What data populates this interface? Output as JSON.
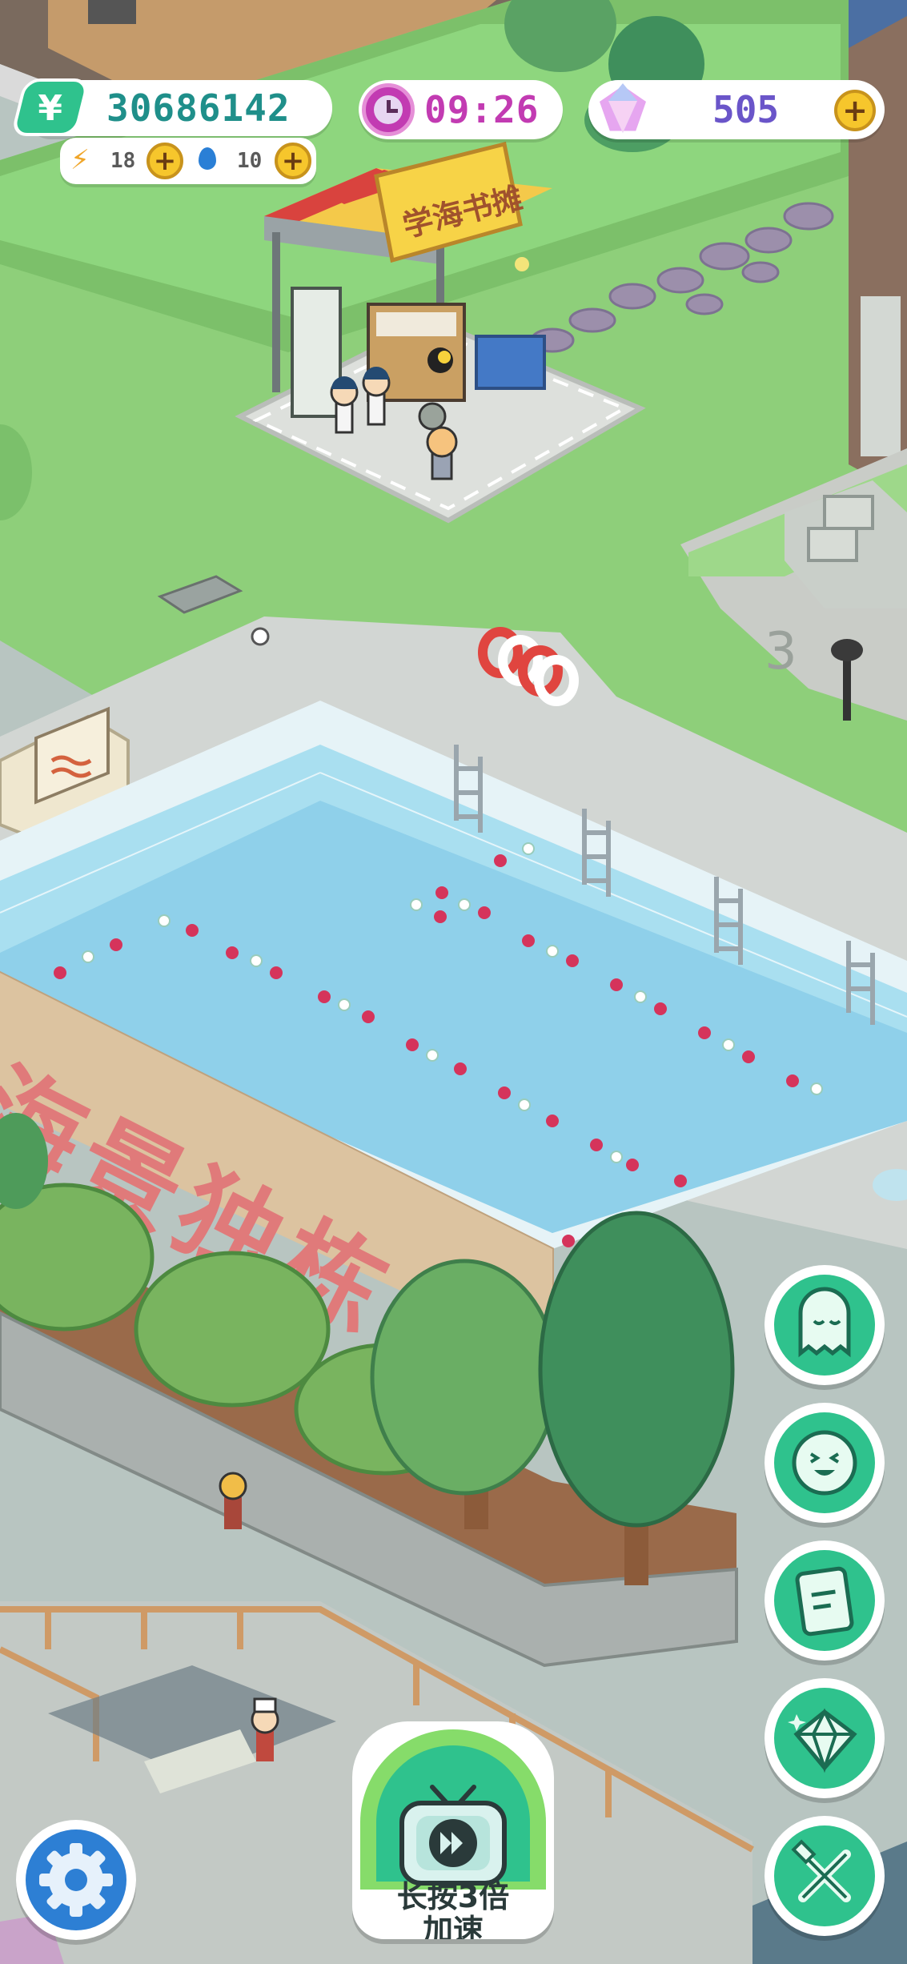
{
  "hud": {
    "money": "30686142",
    "money_icon": "yuan-icon",
    "energy": "18",
    "water": "10",
    "time": "09:26",
    "gems": "505"
  },
  "stall": {
    "sign": "学海书摊"
  },
  "wall": {
    "slogan": "海景独栋"
  },
  "zone": {
    "label": "3"
  },
  "speedup": {
    "line1": "长按3倍",
    "line2": "加速"
  },
  "side_buttons": [
    "ghost-chat-icon",
    "smile-face-icon",
    "notebook-icon",
    "gem-shop-icon",
    "tools-icon"
  ],
  "colors": {
    "accent": "#2fc28d",
    "money_text": "#1f8f8a",
    "time_text": "#c23bb2",
    "gem_text": "#6a55c9",
    "pool_water": "#8fd0ea",
    "grass": "#8ecf7a"
  }
}
